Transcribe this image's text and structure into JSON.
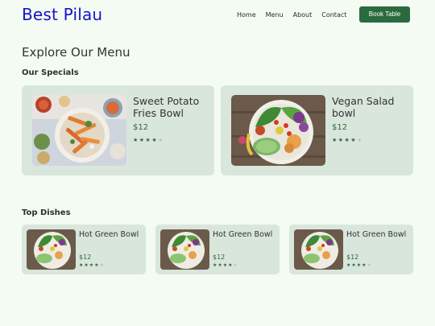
{
  "brand": {
    "name": "Best Pilau",
    "color": "#1414c8"
  },
  "nav": {
    "items": [
      {
        "label": "Home"
      },
      {
        "label": "Menu"
      },
      {
        "label": "About"
      },
      {
        "label": "Contact"
      }
    ],
    "cta_label": "Book Table"
  },
  "page_title": "Explore Our Menu",
  "specials": {
    "title": "Our Specials",
    "items": [
      {
        "name": "Sweet Potato Fries Bowl",
        "price": "$12",
        "rating": 4,
        "max_rating": 5,
        "image": "sweet-potato-fries-bowl-photo"
      },
      {
        "name": "Vegan Salad bowl",
        "price": "$12",
        "rating": 4,
        "max_rating": 5,
        "image": "vegan-salad-bowl-photo"
      }
    ]
  },
  "top_dishes": {
    "title": "Top Dishes",
    "items": [
      {
        "name": "Hot Green Bowl",
        "price": "$12",
        "rating": 4,
        "max_rating": 5,
        "image": "hot-green-bowl-photo"
      },
      {
        "name": "Hot Green Bowl",
        "price": "$12",
        "rating": 4,
        "max_rating": 5,
        "image": "hot-green-bowl-photo"
      },
      {
        "name": "Hot Green Bowl",
        "price": "$12",
        "rating": 4,
        "max_rating": 5,
        "image": "hot-green-bowl-photo"
      }
    ]
  },
  "colors": {
    "background": "#f4fbf3",
    "card": "#d9e6dc",
    "accent": "#2b6a3c"
  }
}
